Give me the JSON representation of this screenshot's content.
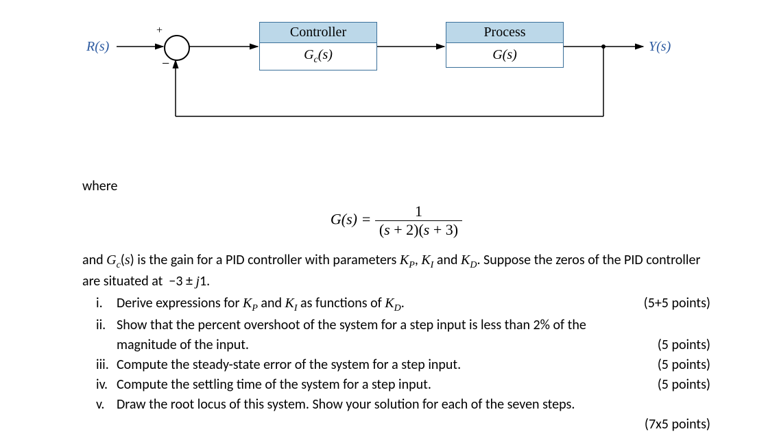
{
  "diagram": {
    "input_label": "R(s)",
    "output_label": "Y(s)",
    "plus": "+",
    "minus": "−",
    "controller_head": "Controller",
    "controller_body": "G_c(s)",
    "process_head": "Process",
    "process_body": "G(s)"
  },
  "where": "where",
  "equation": {
    "lhs": "G(s) =",
    "num": "1",
    "den": "(s + 2)(s + 3)"
  },
  "para1": "and G_c(s) is the gain for a PID controller with parameters K_P, K_I and K_D. Suppose the zeros of the PID controller are situated at −3 ± j1.",
  "items": [
    {
      "marker": "i.",
      "text": "Derive expressions for K_P and K_I as functions of K_D.",
      "points": "(5+5 points)"
    },
    {
      "marker": "ii.",
      "text": "Show that the percent overshoot of the system for a step input is less than 2% of the magnitude of the input.",
      "points": "(5 points)"
    },
    {
      "marker": "iii.",
      "text": "Compute the steady-state error of the system for a step input.",
      "points": "(5 points)"
    },
    {
      "marker": "iv.",
      "text": "Compute the settling time of the system for a step input.",
      "points": "(5 points)"
    },
    {
      "marker": "v.",
      "text": "Draw the root locus of this system. Show your solution for each of the seven steps.",
      "points": ""
    }
  ],
  "last_points": "(7x5 points)"
}
